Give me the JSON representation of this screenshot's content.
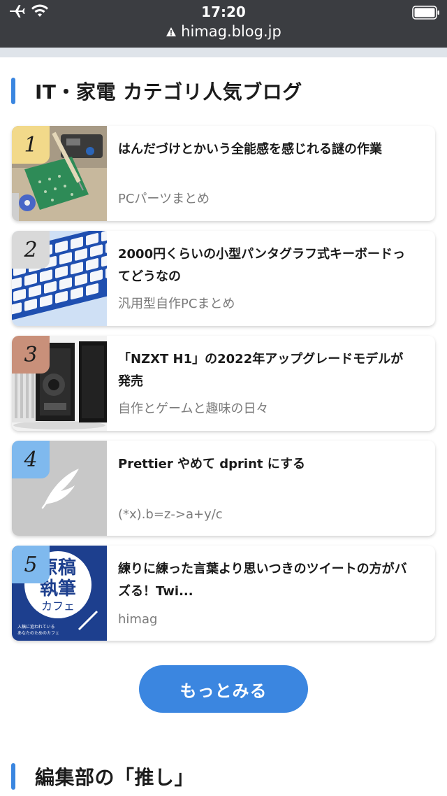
{
  "statusbar": {
    "time": "17:20",
    "url": "himag.blog.jp",
    "icons": [
      "airplane-icon",
      "wifi-icon",
      "warning-icon",
      "battery-icon"
    ]
  },
  "section1": {
    "title": "IT・家電 カテゴリ人気ブログ"
  },
  "ranking": [
    {
      "rank": "1",
      "title": "はんだづけとかいう全能感を感じれる謎の作業",
      "source": "PCパーツまとめ",
      "badge_color": "#f2d98a"
    },
    {
      "rank": "2",
      "title": "2000円くらいの小型パンタグラフ式キーボードってどうなの",
      "source": "汎用型自作PCまとめ",
      "badge_color": "#d9d9d9"
    },
    {
      "rank": "3",
      "title": "「NZXT H1」の2022年アップグレードモデルが発売",
      "source": "自作とゲームと趣味の日々",
      "badge_color": "#c9907a"
    },
    {
      "rank": "4",
      "title": "Prettier やめて dprint にする",
      "source": "(*x).b=z->a+y/c",
      "badge_color": "#7fb9ee"
    },
    {
      "rank": "5",
      "title": "練りに練った言葉より思いつきのツイートの方がバズる！Twi...",
      "source": "himag",
      "badge_color": "#7fb9ee"
    }
  ],
  "thumb5": {
    "line1": "原稿",
    "line2": "執筆",
    "line3": "カフェ",
    "caption1": "入稿に追われている",
    "caption2": "あなたのためのカフェ"
  },
  "more_button": {
    "label": "もっとみる"
  },
  "section2": {
    "title": "編集部の「推し」"
  },
  "colors": {
    "accent": "#3b86e0",
    "statusbar": "#3b3d41"
  }
}
